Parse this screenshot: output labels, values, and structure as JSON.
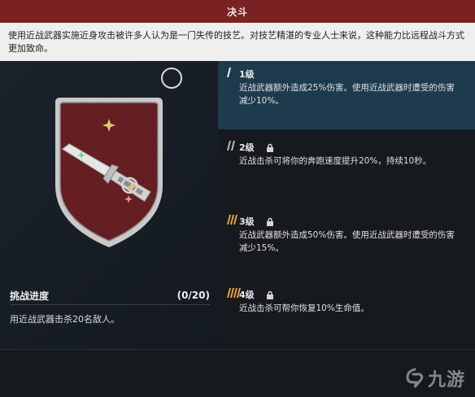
{
  "title": "决斗",
  "description": "使用近战武器实施近身攻击被许多人认为是一门失传的技艺。对技艺精湛的专业人士来说，这种能力比远程战斗方式更加致命。",
  "challenge": {
    "heading": "挑战进度",
    "count": "(0/20)",
    "task": "用近战武器击杀20名敌人。"
  },
  "tiers": [
    {
      "label": "1级",
      "text": "近战武器额外造成25%伤害。使用近战武器时遭受的伤害减少10%。",
      "locked": false,
      "active": true
    },
    {
      "label": "2级",
      "text": "近战击杀可将你的奔跑速度提升20%，持续10秒。",
      "locked": true,
      "active": false
    },
    {
      "label": "3级",
      "text": "近战武器额外造成50%伤害。使用近战武器时遭受的伤害减少15%。",
      "locked": true,
      "active": false
    },
    {
      "label": "4级",
      "text": "近战击杀可帮你恢复10%生命值。",
      "locked": true,
      "active": false
    }
  ],
  "watermark": {
    "text": "九游",
    "icon": "jiuyou-logo"
  },
  "colors": {
    "title_bg": "#7a2222",
    "active_tier_bg": "#1d3b4d",
    "tier_mark_active": "#f2f2f2",
    "tier_mark_orange": "#e8a23a",
    "badge_red": "#6e2226"
  }
}
